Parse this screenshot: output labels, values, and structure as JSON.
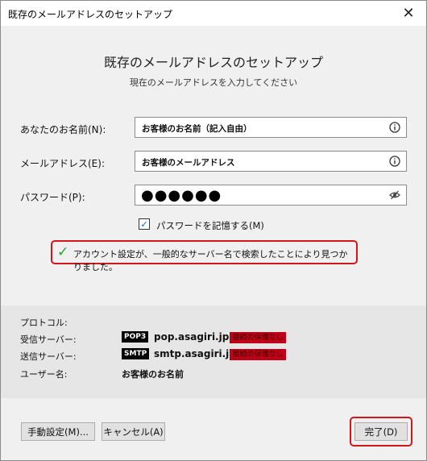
{
  "window": {
    "title": "既存のメールアドレスのセットアップ",
    "close_glyph": "✕"
  },
  "header": {
    "title": "既存のメールアドレスのセットアップ",
    "subtitle": "現在のメールアドレスを入力してください"
  },
  "form": {
    "name_label": "あなたのお名前(N):",
    "name_value": "お客様のお名前（記入自由）",
    "email_label": "メールアドレス(E):",
    "email_value": "お客様のメールアドレス",
    "password_label": "パスワード(P):",
    "password_masked": "●●●●●●",
    "remember_checked": "✓",
    "remember_label": "パスワードを記憶する(M)"
  },
  "status": {
    "found_message": "アカウント設定が、一般的なサーバー名で検索したことにより見つかりました。",
    "found_glyph": "✓"
  },
  "servers": {
    "protocol_label": "プロトコル:",
    "incoming_label": "受信サーバー:",
    "outgoing_label": "送信サーバー:",
    "username_label": "ユーザー名:",
    "incoming_protocol": "POP3",
    "incoming_host": "pop.asagiri.jp",
    "incoming_security": "接続の保護なし",
    "outgoing_protocol": "SMTP",
    "outgoing_host": "smtp.asagiri.jp",
    "outgoing_security": "接続の保護なし",
    "username_value": "お客様のお名前"
  },
  "buttons": {
    "manual": "手動設定(M)...",
    "cancel": "キャンセル(A)",
    "done": "完了(D)"
  },
  "colors": {
    "highlight": "#d0181b",
    "security_badge": "#c00018",
    "check_green": "#1fa22e"
  }
}
